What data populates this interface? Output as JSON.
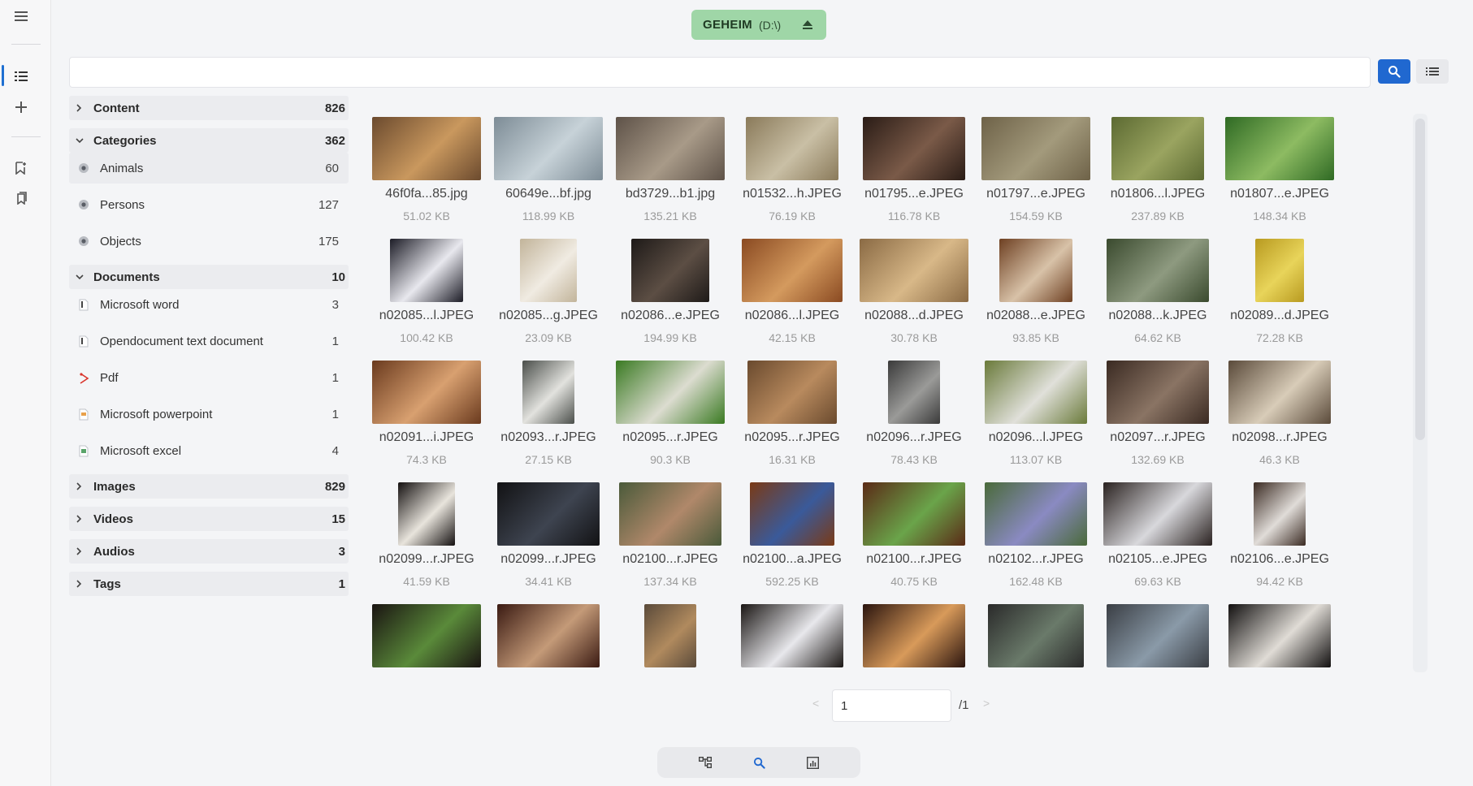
{
  "drive": {
    "name": "GEHEIM",
    "letter": "(D:\\)"
  },
  "search": {
    "value": "",
    "placeholder": ""
  },
  "rail": [
    "menu-icon",
    "list-icon",
    "plus-icon",
    "bookmark-add-icon",
    "bookmarks-icon"
  ],
  "sidebar": {
    "sections": [
      {
        "label": "Content",
        "count": "826",
        "expanded": false,
        "items": []
      },
      {
        "label": "Categories",
        "count": "362",
        "expanded": true,
        "items": [
          {
            "label": "Animals",
            "count": "60",
            "icon": "category-icon",
            "active": true
          },
          {
            "label": "Persons",
            "count": "127",
            "icon": "category-icon"
          },
          {
            "label": "Objects",
            "count": "175",
            "icon": "category-icon"
          }
        ]
      },
      {
        "label": "Documents",
        "count": "10",
        "expanded": true,
        "items": [
          {
            "label": "Microsoft word",
            "count": "3",
            "icon": "word-file-icon"
          },
          {
            "label": "Opendocument text document",
            "count": "1",
            "icon": "odt-file-icon"
          },
          {
            "label": "Pdf",
            "count": "1",
            "icon": "pdf-file-icon"
          },
          {
            "label": "Microsoft powerpoint",
            "count": "1",
            "icon": "powerpoint-file-icon"
          },
          {
            "label": "Microsoft excel",
            "count": "4",
            "icon": "excel-file-icon"
          }
        ]
      },
      {
        "label": "Images",
        "count": "829",
        "expanded": false,
        "items": []
      },
      {
        "label": "Videos",
        "count": "15",
        "expanded": false,
        "items": []
      },
      {
        "label": "Audios",
        "count": "3",
        "expanded": false,
        "items": []
      },
      {
        "label": "Tags",
        "count": "1",
        "expanded": false,
        "items": []
      }
    ]
  },
  "files": [
    {
      "name": "46f0fa...85.jpg",
      "size": "51.02 KB",
      "colors": [
        "#6b4a2e",
        "#c9985e"
      ]
    },
    {
      "name": "60649e...bf.jpg",
      "size": "118.99 KB",
      "colors": [
        "#7d8c96",
        "#c7d2d8"
      ]
    },
    {
      "name": "bd3729...b1.jpg",
      "size": "135.21 KB",
      "colors": [
        "#5e5248",
        "#a89a88"
      ]
    },
    {
      "name": "n01532...h.JPEG",
      "size": "76.19 KB",
      "colors": [
        "#8a7a5a",
        "#c9bfa5"
      ]
    },
    {
      "name": "n01795...e.JPEG",
      "size": "116.78 KB",
      "colors": [
        "#2a1c16",
        "#7a5a48"
      ]
    },
    {
      "name": "n01797...e.JPEG",
      "size": "154.59 KB",
      "colors": [
        "#6e6248",
        "#a39a7c"
      ]
    },
    {
      "name": "n01806...l.JPEG",
      "size": "237.89 KB",
      "colors": [
        "#5c6a32",
        "#9aa460"
      ]
    },
    {
      "name": "n01807...e.JPEG",
      "size": "148.34 KB",
      "colors": [
        "#2f6a24",
        "#8dbb62"
      ]
    },
    {
      "name": "n02085...l.JPEG",
      "size": "100.42 KB",
      "colors": [
        "#1c1c26",
        "#e8e8ee"
      ]
    },
    {
      "name": "n02085...g.JPEG",
      "size": "23.09 KB",
      "colors": [
        "#c2b49a",
        "#f0ebe2"
      ]
    },
    {
      "name": "n02086...e.JPEG",
      "size": "194.99 KB",
      "colors": [
        "#1e1a18",
        "#5c4e44"
      ]
    },
    {
      "name": "n02086...l.JPEG",
      "size": "42.15 KB",
      "colors": [
        "#8a4a22",
        "#d49a5e"
      ]
    },
    {
      "name": "n02088...d.JPEG",
      "size": "30.78 KB",
      "colors": [
        "#8a6a44",
        "#d8b888"
      ]
    },
    {
      "name": "n02088...e.JPEG",
      "size": "93.85 KB",
      "colors": [
        "#6e4022",
        "#d8c2a8"
      ]
    },
    {
      "name": "n02088...k.JPEG",
      "size": "64.62 KB",
      "colors": [
        "#3a4a2e",
        "#8e9a80"
      ]
    },
    {
      "name": "n02089...d.JPEG",
      "size": "72.28 KB",
      "colors": [
        "#b89a20",
        "#e8d45a"
      ]
    },
    {
      "name": "n02091...i.JPEG",
      "size": "74.3 KB",
      "colors": [
        "#6a3a1e",
        "#d8a070"
      ]
    },
    {
      "name": "n02093...r.JPEG",
      "size": "27.15 KB",
      "colors": [
        "#4a4e4a",
        "#e2e2de"
      ]
    },
    {
      "name": "n02095...r.JPEG",
      "size": "90.3 KB",
      "colors": [
        "#3a7a22",
        "#dcdcd0"
      ]
    },
    {
      "name": "n02095...r.JPEG",
      "size": "16.31 KB",
      "colors": [
        "#6a4a2e",
        "#b88a5e"
      ]
    },
    {
      "name": "n02096...r.JPEG",
      "size": "78.43 KB",
      "colors": [
        "#3a3a3a",
        "#9a9a98"
      ]
    },
    {
      "name": "n02096...l.JPEG",
      "size": "113.07 KB",
      "colors": [
        "#6a7a3a",
        "#e0e0da"
      ]
    },
    {
      "name": "n02097...r.JPEG",
      "size": "132.69 KB",
      "colors": [
        "#3a2a22",
        "#8a7464"
      ]
    },
    {
      "name": "n02098...r.JPEG",
      "size": "46.3 KB",
      "colors": [
        "#5a4a3a",
        "#d8ccb8"
      ]
    },
    {
      "name": "n02099...r.JPEG",
      "size": "41.59 KB",
      "colors": [
        "#141010",
        "#e8e4dc"
      ]
    },
    {
      "name": "n02099...r.JPEG",
      "size": "34.41 KB",
      "colors": [
        "#121214",
        "#3e4450"
      ]
    },
    {
      "name": "n02100...r.JPEG",
      "size": "137.34 KB",
      "colors": [
        "#4a5a3a",
        "#b0886a"
      ]
    },
    {
      "name": "n02100...a.JPEG",
      "size": "592.25 KB",
      "colors": [
        "#7a3a16",
        "#3a5a9a"
      ]
    },
    {
      "name": "n02100...r.JPEG",
      "size": "40.75 KB",
      "colors": [
        "#5a2a16",
        "#6aa44a"
      ]
    },
    {
      "name": "n02102...r.JPEG",
      "size": "162.48 KB",
      "colors": [
        "#4a6a3a",
        "#8a8ac2"
      ]
    },
    {
      "name": "n02105...e.JPEG",
      "size": "69.63 KB",
      "colors": [
        "#2a2220",
        "#d8d8dc"
      ]
    },
    {
      "name": "n02106...e.JPEG",
      "size": "94.42 KB",
      "colors": [
        "#3a2a22",
        "#e0dcd8"
      ]
    },
    {
      "name": "",
      "size": "",
      "colors": [
        "#1a1412",
        "#5a8a3a"
      ]
    },
    {
      "name": "",
      "size": "",
      "colors": [
        "#3a1a12",
        "#c49a78"
      ]
    },
    {
      "name": "",
      "size": "",
      "colors": [
        "#5a4a3a",
        "#b08a5e"
      ]
    },
    {
      "name": "",
      "size": "",
      "colors": [
        "#1a1614",
        "#e8e8ec"
      ]
    },
    {
      "name": "",
      "size": "",
      "colors": [
        "#2a140e",
        "#d89a5a"
      ]
    },
    {
      "name": "",
      "size": "",
      "colors": [
        "#2a2a2a",
        "#6a7a6a"
      ]
    },
    {
      "name": "",
      "size": "",
      "colors": [
        "#3a3e44",
        "#8a9aa8"
      ]
    },
    {
      "name": "",
      "size": "",
      "colors": [
        "#121010",
        "#e0dcd6"
      ]
    }
  ],
  "pagination": {
    "current": "1",
    "total": "/1",
    "prev": "<",
    "next": ">"
  },
  "bottom_toolbar": [
    "tree-view-icon",
    "search-icon",
    "stats-icon"
  ],
  "colors": {
    "accent": "#2068d0",
    "drive_chip": "#9fd6a7"
  }
}
